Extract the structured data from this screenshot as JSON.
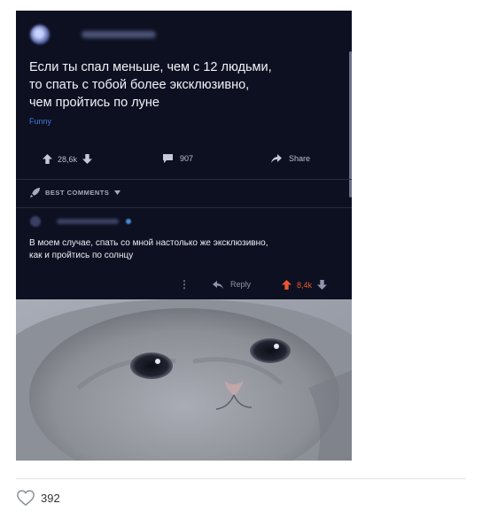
{
  "post": {
    "title": "Если ты спал меньше, чем с 12 людьми,\nто спать с тобой более эксклюзивно,\nчем пройтись по луне",
    "flair": "Funny",
    "upvotes": "28,6k",
    "comments": "907",
    "share_label": "Share"
  },
  "comments_sort": {
    "label": "BEST COMMENTS"
  },
  "top_comment": {
    "text": "В моем случае, спать со мной настолько же эксклюзивно,\nкак и пройтись по солнцу",
    "reply_label": "Reply",
    "votes": "8,4k",
    "more": "⋮"
  },
  "likes": {
    "count": "392"
  },
  "colors": {
    "background": "#0d1021",
    "upvote_active": "#e9552f",
    "flair": "#3a7be0",
    "text": "#f2f3f7"
  },
  "icons": [
    "avatar-blurred",
    "arrow-up-icon",
    "arrow-down-icon",
    "comment-icon",
    "share-icon",
    "rocket-icon",
    "chevron-down-icon",
    "more-icon",
    "reply-icon",
    "heart-icon"
  ]
}
